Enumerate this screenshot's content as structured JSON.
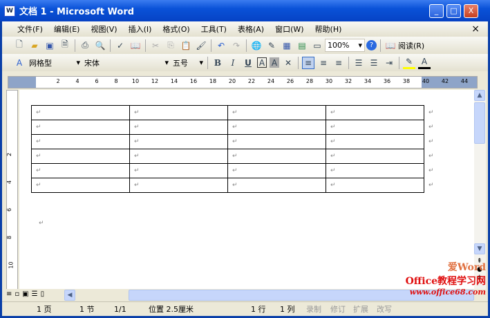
{
  "window": {
    "title": "文档 1 - Microsoft Word",
    "minimize": "_",
    "maximize": "□",
    "close": "X"
  },
  "menu": {
    "items": [
      "文件(F)",
      "编辑(E)",
      "视图(V)",
      "插入(I)",
      "格式(O)",
      "工具(T)",
      "表格(A)",
      "窗口(W)",
      "帮助(H)"
    ],
    "close": "×"
  },
  "standard_toolbar": {
    "zoom": "100%",
    "read": "阅读(R)"
  },
  "format_toolbar": {
    "style": "网格型",
    "font": "宋体",
    "size": "五号",
    "bold": "B",
    "italic": "I",
    "underline": "U"
  },
  "ruler": {
    "numbers": [
      "2",
      "4",
      "6",
      "8",
      "10",
      "12",
      "14",
      "16",
      "18",
      "20",
      "22",
      "24",
      "26",
      "28",
      "30",
      "32",
      "34",
      "36",
      "38",
      "40",
      "42",
      "44"
    ]
  },
  "vruler": {
    "numbers": [
      "2",
      "4",
      "6",
      "8",
      "10",
      "12"
    ]
  },
  "table": {
    "rows": 6,
    "cols": 4,
    "cell_mark": "↵"
  },
  "paragraph_mark": "↵",
  "status": {
    "page": "1 页",
    "section": "1 节",
    "pages": "1/1",
    "position": "位置 2.5厘米",
    "line": "1 行",
    "col": "1 列",
    "rec": "录制",
    "trk": "修订",
    "ext": "扩展",
    "ovr": "改写"
  },
  "watermark": {
    "line1": "爱Word",
    "line2": "Office教程学习网",
    "line3": "www.office68.com"
  }
}
